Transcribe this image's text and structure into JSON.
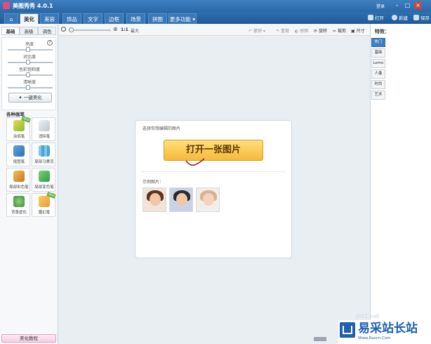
{
  "app": {
    "title": "美图秀秀 4.0.1",
    "login": "登录"
  },
  "menu": {
    "tabs": [
      "美化",
      "美容",
      "饰品",
      "文字",
      "边框",
      "场景",
      "拼图",
      "更多功能"
    ],
    "right": {
      "open": "打开",
      "new": "新建",
      "save": "保存"
    }
  },
  "left": {
    "subtabs": [
      "基础",
      "高级",
      "调色"
    ],
    "sliders": [
      {
        "label": "亮度",
        "value": 0.45
      },
      {
        "label": "对比度",
        "value": 0.45
      },
      {
        "label": "色彩饱和度",
        "value": 0.45
      },
      {
        "label": "清晰度",
        "value": 0.45
      }
    ],
    "onekey": "一键美化",
    "section_title": "各种画笔",
    "tools": [
      {
        "label": "涂鸦笔",
        "icon": "pencil-icon",
        "new": true
      },
      {
        "label": "消除笔",
        "icon": "eraser-icon",
        "new": false
      },
      {
        "label": "抠图笔",
        "icon": "cutout-icon",
        "new": false
      },
      {
        "label": "局部马赛克",
        "icon": "mosaic-icon",
        "new": false
      },
      {
        "label": "局部彩色笔",
        "icon": "color-brush-icon",
        "new": false
      },
      {
        "label": "局部变色笔",
        "icon": "recolor-icon",
        "new": false
      },
      {
        "label": "背景虚化",
        "icon": "blur-icon",
        "new": false
      },
      {
        "label": "魔幻笔",
        "icon": "magic-wand-icon",
        "new": true
      }
    ],
    "new_badge": "NEW",
    "tutorial": "美化教程"
  },
  "toolbar": {
    "zoom_value": "1:1",
    "zoom_max": "最大",
    "undo": "撤销",
    "redo": "重做",
    "original": "原图",
    "rotate": "旋转",
    "crop": "裁剪",
    "size": "尺寸"
  },
  "dialog": {
    "prompt": "选择你想编辑的图片",
    "open_button": "打开一张图片",
    "examples_label": "示例图片："
  },
  "right": {
    "title": "特效：",
    "tabs": [
      "热门",
      "基础",
      "Lomo",
      "人像",
      "时尚",
      "艺术"
    ]
  },
  "watermark": {
    "name": "易采站长站",
    "url": "Www.Eaxcn.Com",
    "faint": "jb51.net"
  },
  "colors": {
    "accent": "#2f6fb0",
    "button": "#f6b93b",
    "active_tab": "#3d7fc2"
  }
}
